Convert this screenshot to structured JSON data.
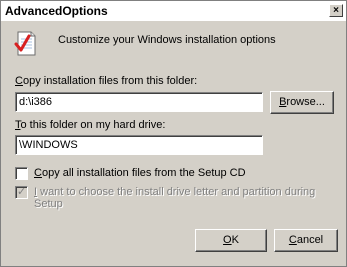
{
  "window": {
    "title": "AdvancedOptions",
    "close_glyph": "×"
  },
  "header": {
    "icon": "checklist-document-icon",
    "text": "Customize your Windows installation options"
  },
  "source": {
    "label_accel": "C",
    "label_rest": "opy installation files from this folder:",
    "value": "d:\\i386",
    "browse_accel": "B",
    "browse_rest": "rowse..."
  },
  "target": {
    "label_accel": "T",
    "label_rest": "o this folder on my hard drive:",
    "value": "\\WINDOWS"
  },
  "options": {
    "copy_accel": "C",
    "copy_rest": "opy all installation files from the Setup CD",
    "copy_checked": false,
    "choose_accel": "I",
    "choose_rest": " want to choose the install drive letter and partition during Setup",
    "choose_checked": true,
    "choose_enabled": false
  },
  "buttons": {
    "ok_accel": "O",
    "ok_rest": "K",
    "cancel_accel": "C",
    "cancel_rest": "ancel"
  }
}
